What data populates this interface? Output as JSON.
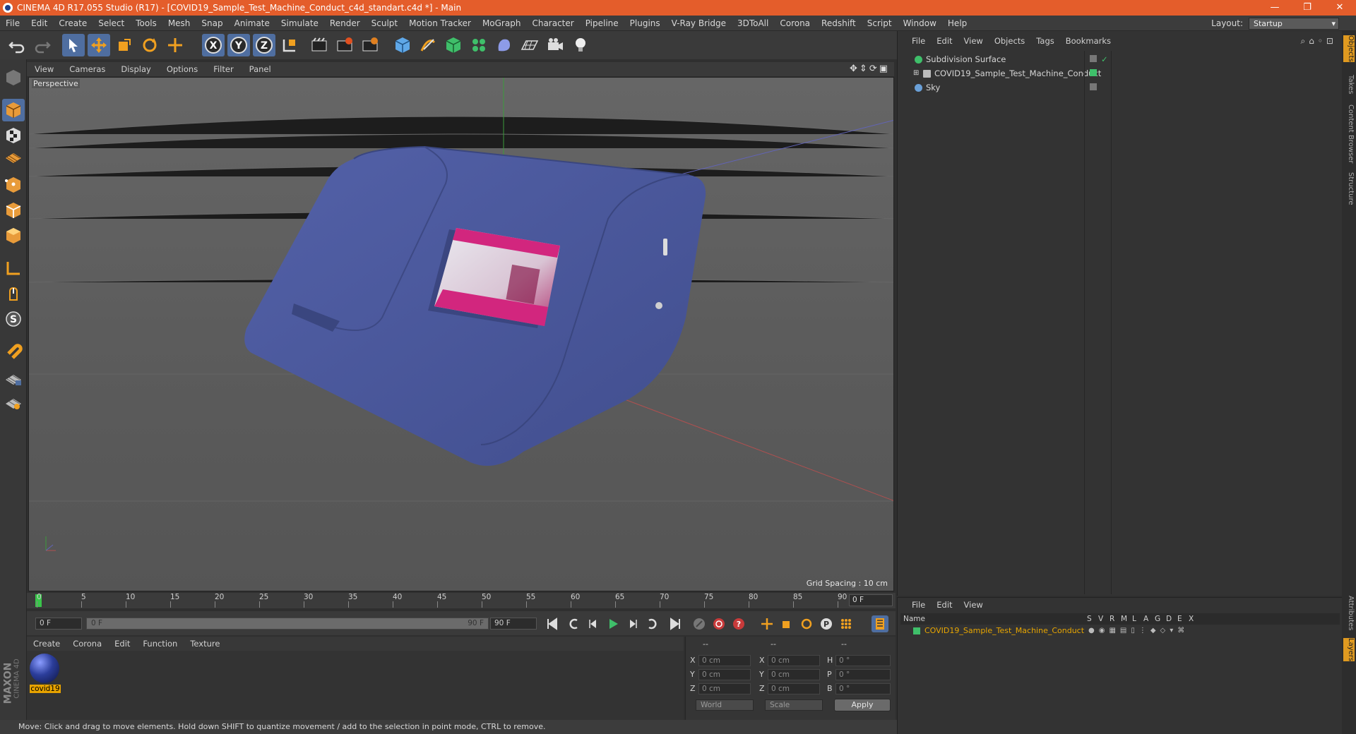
{
  "window": {
    "title": "CINEMA 4D R17.055 Studio (R17) - [COVID19_Sample_Test_Machine_Conduct_c4d_standart.c4d *] - Main",
    "controls": [
      "—",
      "❐",
      "✕"
    ]
  },
  "menubar": {
    "items": [
      "File",
      "Edit",
      "Create",
      "Select",
      "Tools",
      "Mesh",
      "Snap",
      "Animate",
      "Simulate",
      "Render",
      "Sculpt",
      "Motion Tracker",
      "MoGraph",
      "Character",
      "Pipeline",
      "Plugins",
      "V-Ray Bridge",
      "3DToAll",
      "Corona",
      "Redshift",
      "Script",
      "Window",
      "Help"
    ],
    "layout_label": "Layout:",
    "layout_value": "Startup"
  },
  "toolbar": {
    "icons": [
      "undo-icon",
      "redo-icon",
      "select-icon",
      "move-icon",
      "scale-icon",
      "rotate-icon",
      "live-select-icon",
      "x-axis-icon",
      "y-axis-icon",
      "z-axis-icon",
      "coordinate-system-icon",
      "render-view-icon",
      "render-picture-icon",
      "render-settings-icon",
      "cube-icon",
      "pen-icon",
      "subdivision-icon",
      "cloner-icon",
      "deformer-icon",
      "floor-icon",
      "camera-icon",
      "light-icon"
    ]
  },
  "viewport": {
    "menu": [
      "View",
      "Cameras",
      "Display",
      "Options",
      "Filter",
      "Panel"
    ],
    "label": "Perspective",
    "grid_spacing": "Grid Spacing : 10 cm"
  },
  "timeline": {
    "ticks": [
      "0",
      "5",
      "10",
      "15",
      "20",
      "25",
      "30",
      "35",
      "40",
      "45",
      "50",
      "55",
      "60",
      "65",
      "70",
      "75",
      "80",
      "85",
      "90"
    ],
    "current_frame": "0 F",
    "start_field": "0 F",
    "range_start": "0 F",
    "range_end": "90 F",
    "end_field": "90 F"
  },
  "material_manager": {
    "menu": [
      "Create",
      "Corona",
      "Edit",
      "Function",
      "Texture"
    ],
    "material_name": "covid19"
  },
  "branding": {
    "maxon": "MAXON",
    "product": "CINEMA 4D"
  },
  "coordinates": {
    "headers": [
      "--",
      "--",
      "--"
    ],
    "rows": [
      {
        "a": "X",
        "av": "0 cm",
        "b": "X",
        "bv": "0 cm",
        "c": "H",
        "cv": "0 °"
      },
      {
        "a": "Y",
        "av": "0 cm",
        "b": "Y",
        "bv": "0 cm",
        "c": "P",
        "cv": "0 °"
      },
      {
        "a": "Z",
        "av": "0 cm",
        "b": "Z",
        "bv": "0 cm",
        "c": "B",
        "cv": "0 °"
      }
    ],
    "mode1": "World",
    "mode2": "Scale",
    "apply": "Apply"
  },
  "statusbar": {
    "text": "Move: Click and drag to move elements. Hold down SHIFT to quantize movement / add to the selection in point mode, CTRL to remove."
  },
  "object_manager": {
    "menu": [
      "File",
      "Edit",
      "View",
      "Objects",
      "Tags",
      "Bookmarks"
    ],
    "objects": [
      {
        "name": "Subdivision Surface",
        "color": "#3fbf6a"
      },
      {
        "name": "COVID19_Sample_Test_Machine_Conduct",
        "color": "#cfcfcf"
      },
      {
        "name": "Sky",
        "color": "#6aa0d8"
      }
    ]
  },
  "right_tabs": [
    "Objects",
    "Takes",
    "Content Browser",
    "Structure",
    "Attributes",
    "Layers"
  ],
  "layer_manager": {
    "menu": [
      "File",
      "Edit",
      "View"
    ],
    "headers": [
      "Name",
      "S",
      "V",
      "R",
      "M",
      "L",
      "A",
      "G",
      "D",
      "E",
      "X"
    ],
    "layer_name": "COVID19_Sample_Test_Machine_Conduct"
  }
}
